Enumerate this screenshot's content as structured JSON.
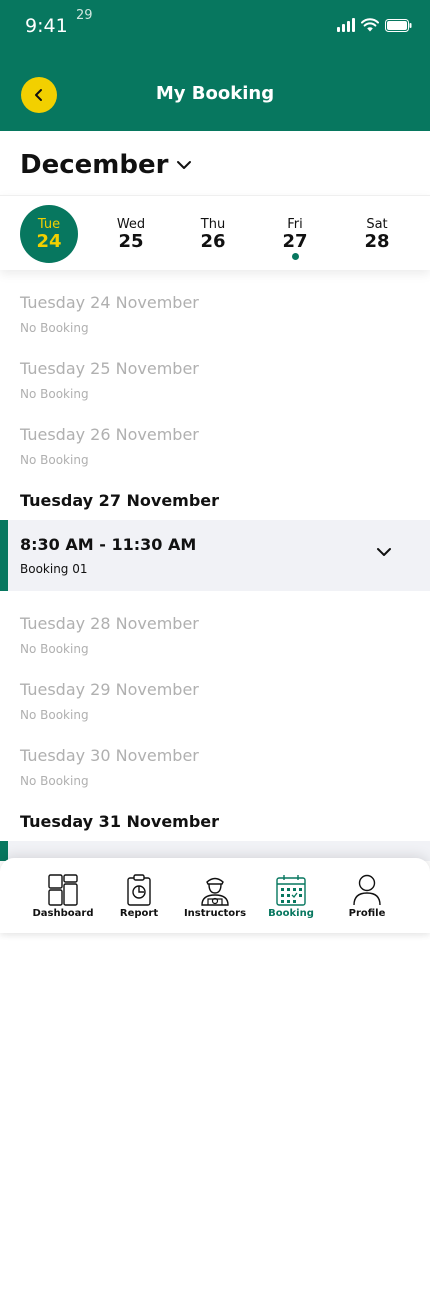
{
  "status_bar": {
    "time": "9:41",
    "tiny_number": "29"
  },
  "header": {
    "title": "My Booking"
  },
  "month": {
    "label": "December"
  },
  "week": [
    {
      "name": "Tue",
      "num": "24",
      "selected": true,
      "has_dot": false
    },
    {
      "name": "Wed",
      "num": "25",
      "selected": false,
      "has_dot": false
    },
    {
      "name": "Thu",
      "num": "26",
      "selected": false,
      "has_dot": false
    },
    {
      "name": "Fri",
      "num": "27",
      "selected": false,
      "has_dot": true
    },
    {
      "name": "Sat",
      "num": "28",
      "selected": false,
      "has_dot": false
    }
  ],
  "days": [
    {
      "title": "Tuesday 24 November",
      "sub": "No Booking"
    },
    {
      "title": "Tuesday 25 November",
      "sub": "No Booking"
    },
    {
      "title": "Tuesday 26 November",
      "sub": "No Booking"
    },
    {
      "title": "Tuesday 27 November",
      "sub": ""
    },
    {
      "title": "Tuesday 28 November",
      "sub": "No Booking"
    },
    {
      "title": "Tuesday 29 November",
      "sub": "No Booking"
    },
    {
      "title": "Tuesday 30 November",
      "sub": "No Booking"
    },
    {
      "title": "Tuesday 31 November",
      "sub": ""
    }
  ],
  "booking": {
    "time": "8:30 AM - 11:30 AM",
    "name": "Booking 01"
  },
  "tabs": [
    {
      "label": "Dashboard",
      "icon": "dashboard-icon",
      "active": false
    },
    {
      "label": "Report",
      "icon": "report-icon",
      "active": false
    },
    {
      "label": "Instructors",
      "icon": "instructor-icon",
      "active": false
    },
    {
      "label": "Booking",
      "icon": "calendar-icon",
      "active": true
    },
    {
      "label": "Profile",
      "icon": "profile-icon",
      "active": false
    }
  ],
  "colors": {
    "primary": "#07775f",
    "accent": "#f2d000",
    "muted": "#b0b0b0",
    "card": "#f1f2f6"
  }
}
